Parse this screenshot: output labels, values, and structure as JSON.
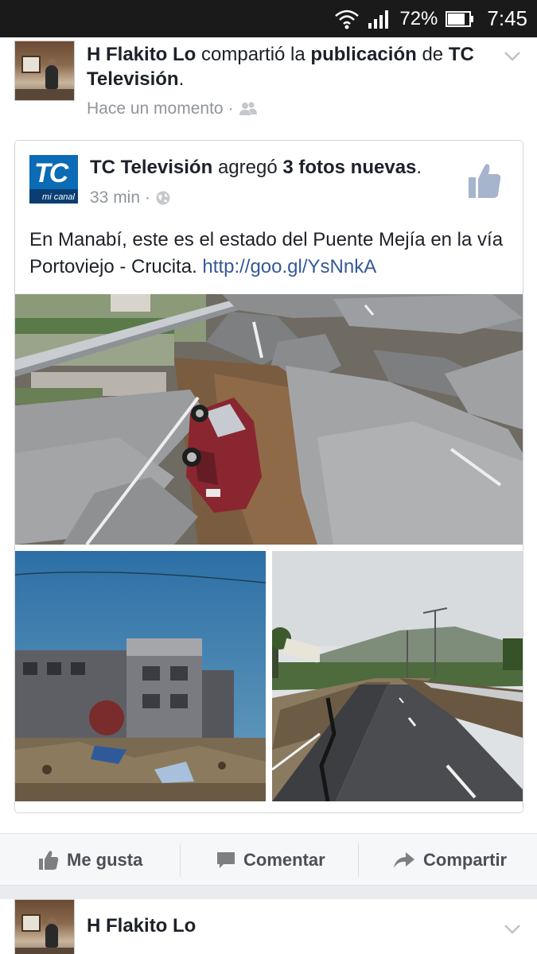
{
  "status_bar": {
    "battery_percent": "72%",
    "time": "7:45",
    "icons": [
      "wifi-icon",
      "signal-icon",
      "battery-icon"
    ]
  },
  "story": {
    "actor": "H Flakito Lo",
    "verb": "compartió la",
    "object": "publicación",
    "preposition": "de",
    "page": "TC Televisión",
    "period": ".",
    "time": "Hace un momento",
    "separator": "·",
    "audience_icon": "friends-icon"
  },
  "shared_post": {
    "page_name": "TC Televisión",
    "action_text": "agregó",
    "photos_count_text": "3 fotos nuevas",
    "period": ".",
    "time": "33 min",
    "separator": "·",
    "audience_icon": "globe-icon",
    "text": "En Manabí, este es el estado del Puente Mejía en la vía Portoviejo - Crucita.",
    "link": "http://goo.gl/YsNnkA",
    "logo_letters": "TC",
    "logo_tag": "mi canal",
    "photos": [
      {
        "name": "photo-collapsed-bridge-car"
      },
      {
        "name": "photo-damaged-building"
      },
      {
        "name": "photo-cracked-highway"
      }
    ]
  },
  "actions": {
    "like_label": "Me gusta",
    "comment_label": "Comentar",
    "share_label": "Compartir"
  },
  "next_story": {
    "actor": "H Flakito Lo"
  },
  "colors": {
    "status_bar_bg": "#1a1a1a",
    "link": "#365899",
    "meta_gray": "#90949c",
    "action_gray": "#4b4f56",
    "tc_blue": "#0b6bb5"
  }
}
